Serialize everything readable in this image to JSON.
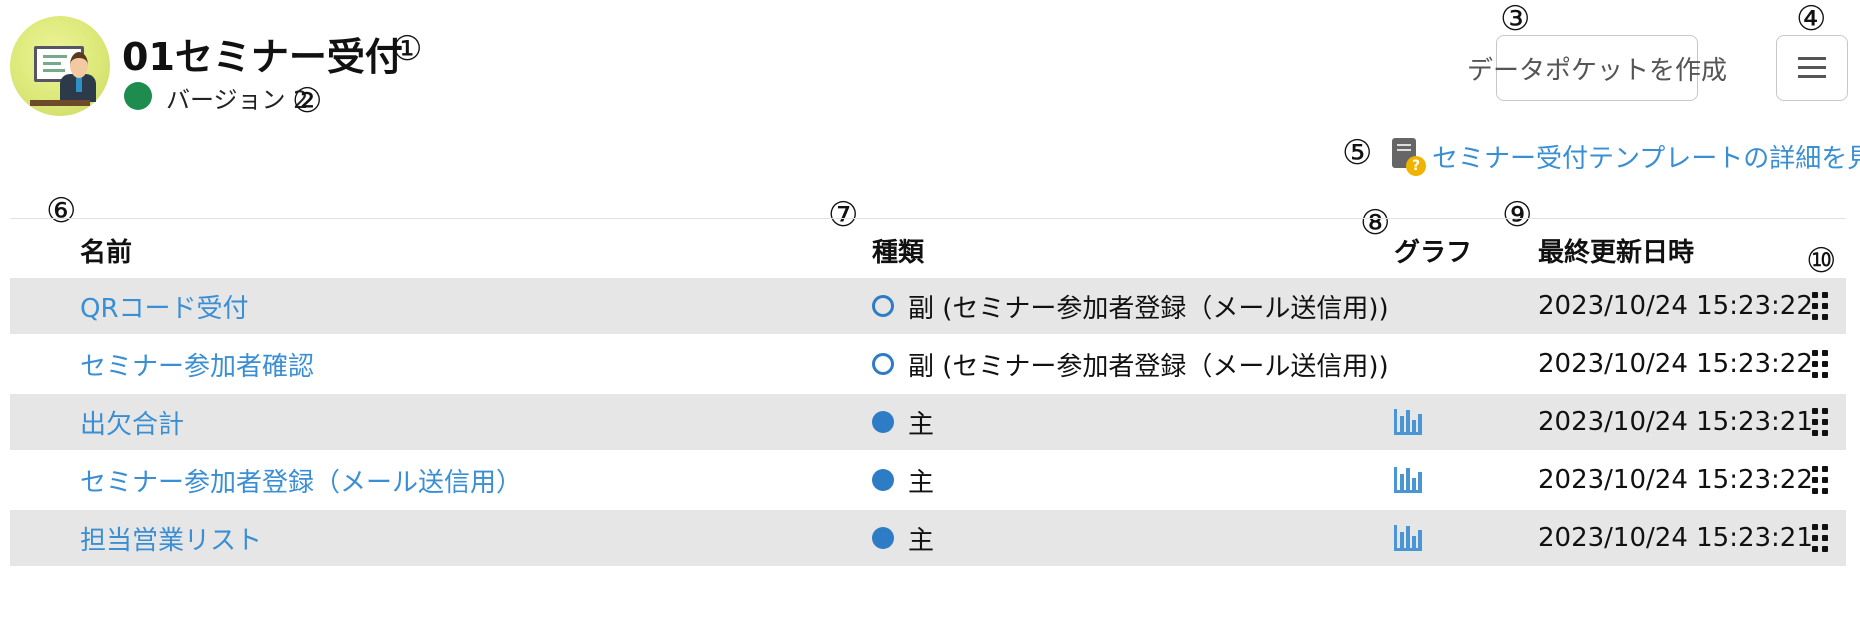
{
  "header": {
    "app_title": "01セミナー受付",
    "version_label": "バージョン 2",
    "status_color": "#1e8c4e",
    "create_pocket_button": "データポケットを作成",
    "menu_icon": "hamburger-menu-icon",
    "template_link": "セミナー受付テンプレートの詳細を見る",
    "template_icon": "document-help-icon"
  },
  "markers": [
    "①",
    "②",
    "③",
    "④",
    "⑤",
    "⑥",
    "⑦",
    "⑧",
    "⑨",
    "⑩"
  ],
  "table": {
    "columns": {
      "name": "名前",
      "type": "種類",
      "graph": "グラフ",
      "updated": "最終更新日時"
    },
    "rows": [
      {
        "name": "QRコード受付",
        "type": "副 (セミナー参加者登録（メール送信用))",
        "type_kind": "sub",
        "has_graph": false,
        "updated": "2023/10/24 15:23:22"
      },
      {
        "name": "セミナー参加者確認",
        "type": "副 (セミナー参加者登録（メール送信用))",
        "type_kind": "sub",
        "has_graph": false,
        "updated": "2023/10/24 15:23:22"
      },
      {
        "name": "出欠合計",
        "type": "主",
        "type_kind": "main",
        "has_graph": true,
        "updated": "2023/10/24 15:23:21"
      },
      {
        "name": "セミナー参加者登録（メール送信用）",
        "type": "主",
        "type_kind": "main",
        "has_graph": true,
        "updated": "2023/10/24 15:23:22"
      },
      {
        "name": "担当営業リスト",
        "type": "主",
        "type_kind": "main",
        "has_graph": true,
        "updated": "2023/10/24 15:23:21"
      }
    ]
  },
  "colors": {
    "link": "#3a8fd4",
    "type_icon": "#2f7cc6",
    "row_alt": "#e6e6e6"
  }
}
